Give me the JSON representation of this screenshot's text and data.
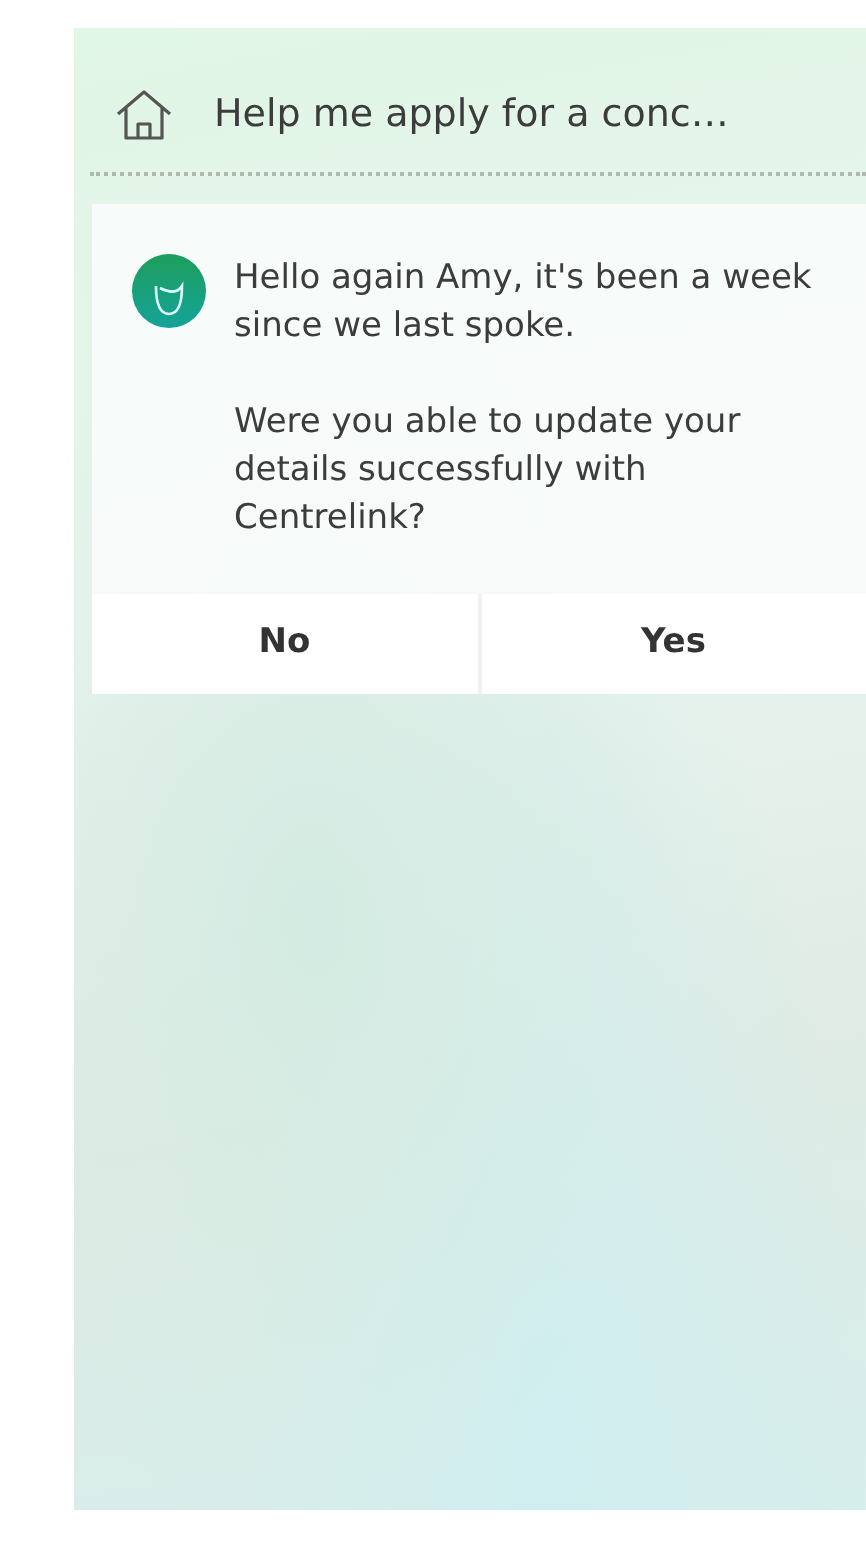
{
  "header": {
    "title": "Help me apply for a conc…"
  },
  "message": {
    "paragraphs": [
      "Hello again Amy, it's been a week since we last spoke.",
      "Were you able to update your details successfully with Centrelink?"
    ]
  },
  "options": [
    {
      "label": "No"
    },
    {
      "label": "Yes"
    }
  ]
}
